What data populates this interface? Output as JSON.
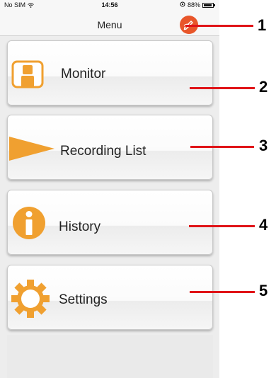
{
  "status_bar": {
    "carrier": "No SIM",
    "time": "14:56",
    "battery": "88%",
    "battery_level": 0.88
  },
  "nav": {
    "title": "Menu",
    "action_icon": "edit-pencil-icon"
  },
  "menu": [
    {
      "label": "Monitor",
      "icon": "person-icon"
    },
    {
      "label": "Recording List",
      "icon": "play-triangle-icon"
    },
    {
      "label": "History",
      "icon": "info-icon"
    },
    {
      "label": "Settings",
      "icon": "gear-icon"
    }
  ],
  "callouts": [
    "1",
    "2",
    "3",
    "4",
    "5"
  ],
  "colors": {
    "accent": "#f0a030",
    "nav_button": "#e8562a",
    "callout_line": "#e01418"
  }
}
